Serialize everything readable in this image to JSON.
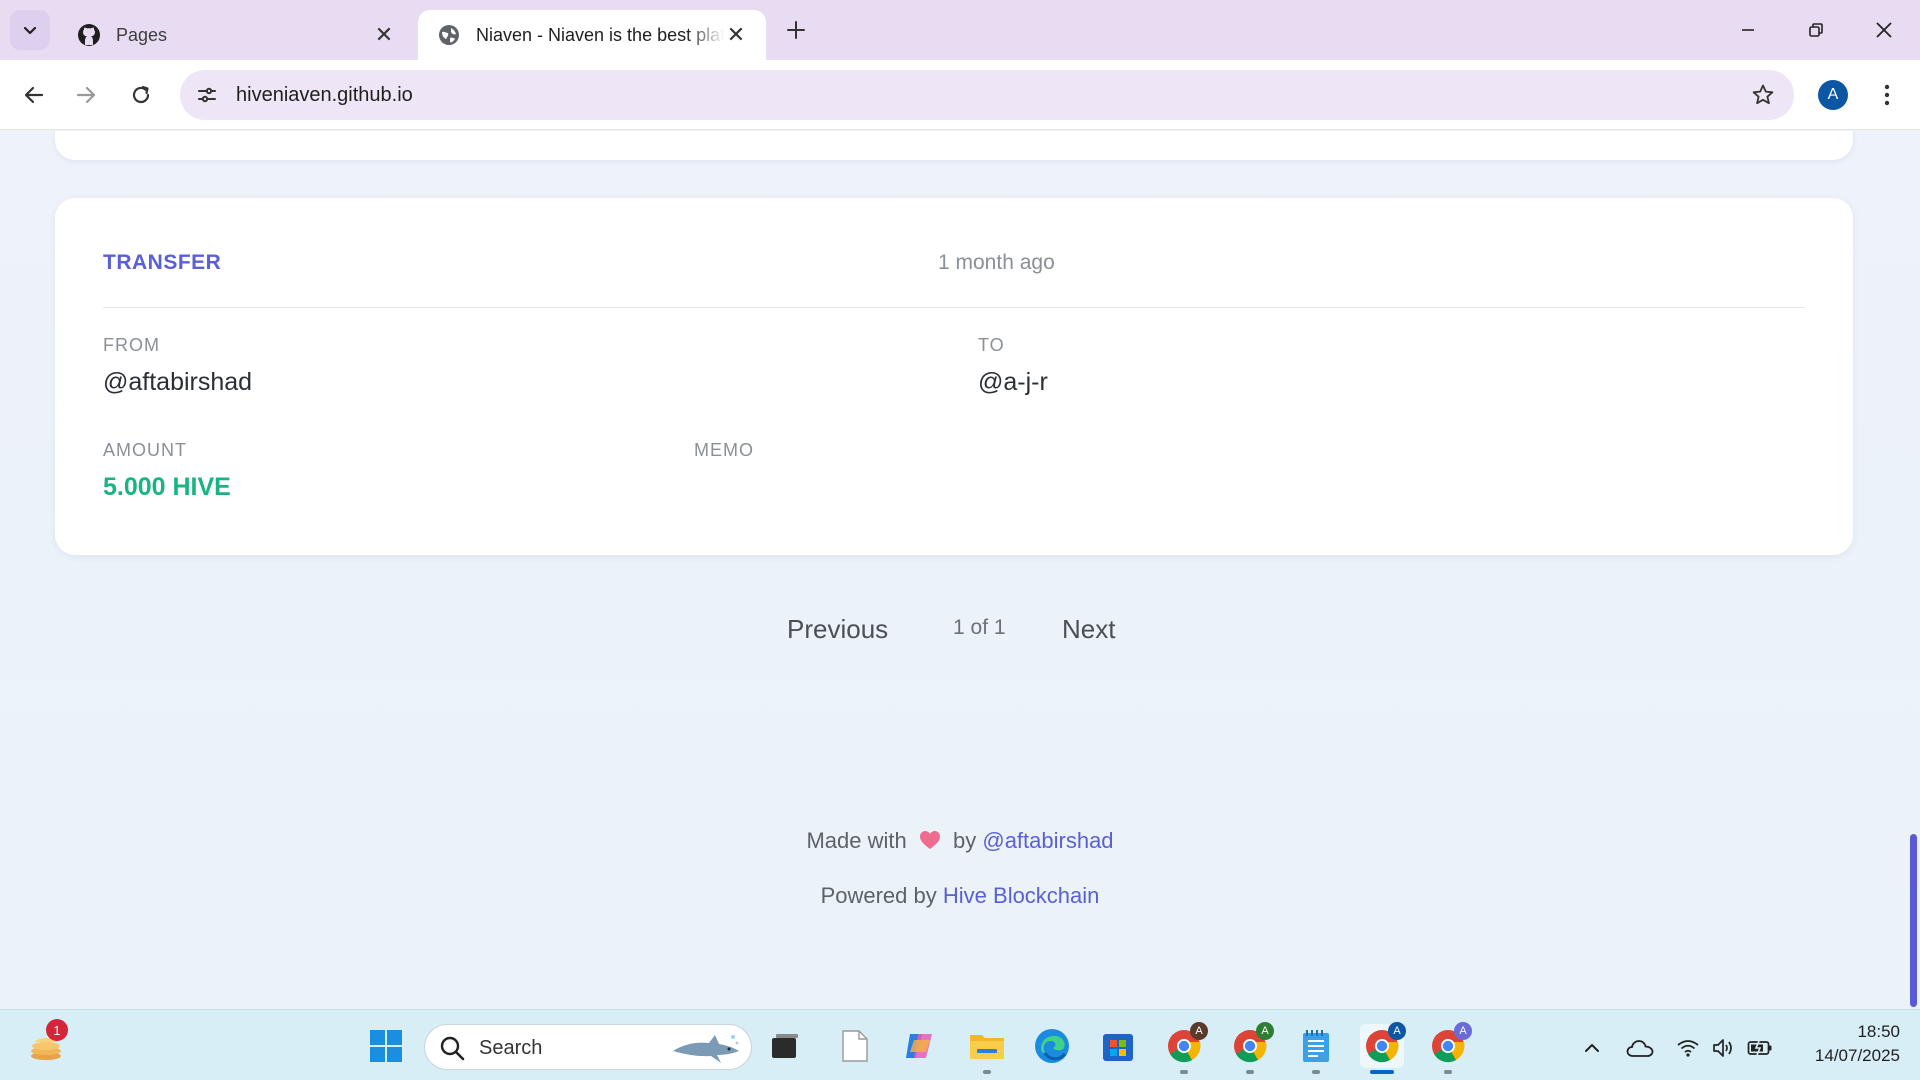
{
  "browser": {
    "tabs": [
      {
        "title": "Pages",
        "icon": "github-icon",
        "active": false
      },
      {
        "title": "Niaven - Niaven is the best platform",
        "icon": "globe-icon",
        "active": true
      }
    ],
    "url": "hiveniaven.github.io",
    "profile_initial": "A"
  },
  "transaction": {
    "type": "TRANSFER",
    "time": "1 month ago",
    "from_label": "FROM",
    "from_value": "@aftabirshad",
    "to_label": "TO",
    "to_value": "@a-j-r",
    "amount_label": "AMOUNT",
    "amount_value": "5.000 HIVE",
    "memo_label": "MEMO",
    "memo_value": ""
  },
  "pagination": {
    "previous_label": "Previous",
    "page_status": "1 of 1",
    "next_label": "Next"
  },
  "footer": {
    "made_with": "Made with",
    "by": "by",
    "author_link": "@aftabirshad",
    "powered_by": "Powered by",
    "platform_link": "Hive Blockchain"
  },
  "taskbar": {
    "search_placeholder": "Search",
    "notification_count": "1",
    "chrome_profile_badges": [
      "A",
      "A",
      "A",
      "A"
    ],
    "clock_time": "18:50",
    "clock_date": "14/07/2025"
  },
  "colors": {
    "accent": "#5b5fd6",
    "amount_green": "#18b583",
    "chrome_blue": "#0b57a4"
  }
}
